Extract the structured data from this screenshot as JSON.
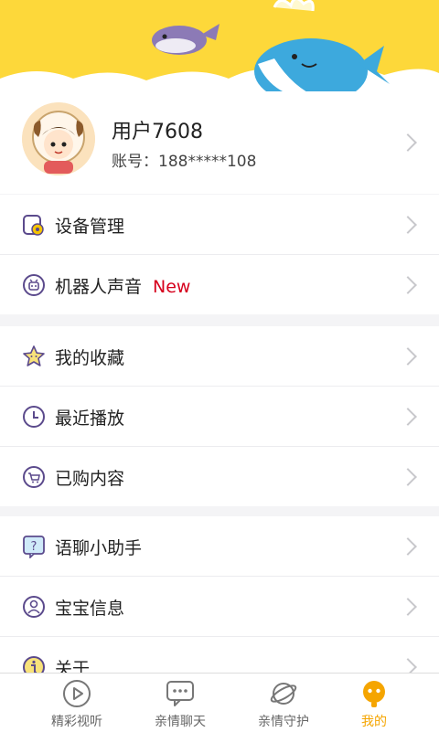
{
  "profile": {
    "username": "用户7608",
    "account_label": "账号：",
    "account_value": "188*****108"
  },
  "menu": {
    "group1": [
      {
        "label": "设备管理",
        "icon": "device-gear-icon"
      },
      {
        "label": "机器人声音",
        "icon": "robot-voice-icon",
        "badge": "New"
      }
    ],
    "group2": [
      {
        "label": "我的收藏",
        "icon": "star-icon"
      },
      {
        "label": "最近播放",
        "icon": "clock-icon"
      },
      {
        "label": "已购内容",
        "icon": "cart-icon"
      }
    ],
    "group3": [
      {
        "label": "语聊小助手",
        "icon": "help-chat-icon"
      },
      {
        "label": "宝宝信息",
        "icon": "baby-profile-icon"
      },
      {
        "label": "关于",
        "icon": "info-icon"
      }
    ]
  },
  "tabs": [
    {
      "label": "精彩视听",
      "icon": "play-circle-icon",
      "active": false
    },
    {
      "label": "亲情聊天",
      "icon": "chat-bubble-icon",
      "active": false
    },
    {
      "label": "亲情守护",
      "icon": "planet-icon",
      "active": false
    },
    {
      "label": "我的",
      "icon": "robot-head-icon",
      "active": true
    }
  ],
  "colors": {
    "header_yellow": "#fdd83a",
    "accent_orange": "#f5a500",
    "new_badge_red": "#d6001c",
    "icon_purple": "#5b4a8c",
    "whale_blue": "#3da9dd"
  }
}
